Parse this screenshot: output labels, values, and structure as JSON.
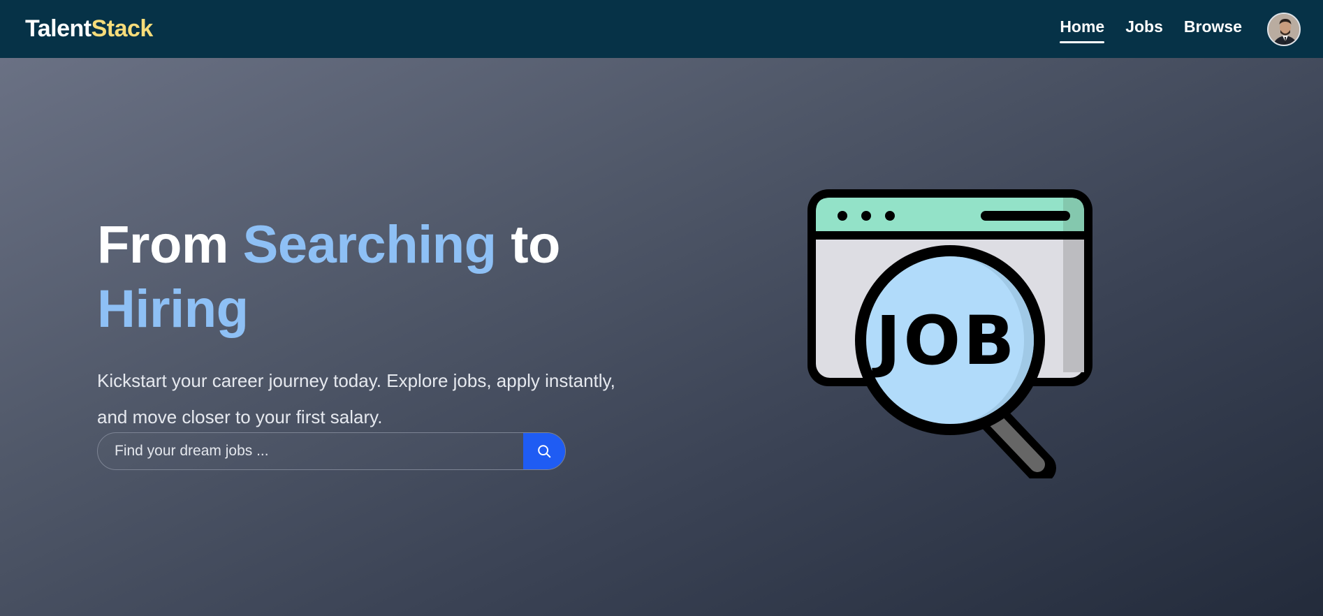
{
  "navbar": {
    "brand_primary": "Talent",
    "brand_accent": "Stack",
    "links": [
      {
        "label": "Home",
        "active": true
      },
      {
        "label": "Jobs",
        "active": false
      },
      {
        "label": "Browse",
        "active": false
      }
    ],
    "avatar_icon": "user-avatar"
  },
  "hero": {
    "title_part1": "From ",
    "title_highlight1": "Searching",
    "title_part2": " to ",
    "title_highlight2": "Hiring",
    "subtitle_line1": "Kickstart your career journey today. Explore jobs, apply instantly,",
    "subtitle_line2": "and move closer to your first salary.",
    "search": {
      "placeholder": "Find your dream jobs ...",
      "value": "",
      "button_icon": "search-icon"
    },
    "illustration_text": "JOB",
    "illustration_icon": "job-search-illustration"
  },
  "colors": {
    "navbar_bg": "#063247",
    "brand_accent": "#f6dc7a",
    "highlight": "#8ec0f5",
    "search_button": "#1f5cf3"
  }
}
